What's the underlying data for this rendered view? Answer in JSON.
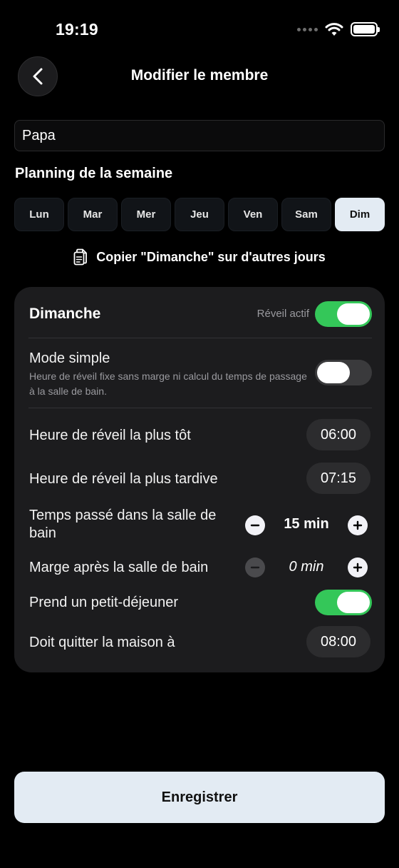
{
  "status_bar": {
    "time": "19:19"
  },
  "header": {
    "title": "Modifier le membre"
  },
  "member": {
    "name": "Papa"
  },
  "schedule": {
    "section_title": "Planning de la semaine",
    "days": [
      "Lun",
      "Mar",
      "Mer",
      "Jeu",
      "Ven",
      "Sam",
      "Dim"
    ],
    "active_day": "Dim",
    "copy_label": "Copier \"Dimanche\" sur d'autres jours"
  },
  "day_card": {
    "title": "Dimanche",
    "alarm_label": "Réveil actif",
    "alarm_active": true,
    "simple_mode": {
      "label": "Mode simple",
      "description": "Heure de réveil fixe sans marge ni calcul du temps de passage à la salle de bain.",
      "enabled": false
    },
    "earliest_wake": {
      "label": "Heure de réveil la plus tôt",
      "value": "06:00"
    },
    "latest_wake": {
      "label": "Heure de réveil la plus tardive",
      "value": "07:15"
    },
    "bathroom_time": {
      "label": "Temps passé dans la salle de bain",
      "value": "15 min"
    },
    "bathroom_margin": {
      "label": "Marge après la salle de bain",
      "value": "0 min"
    },
    "breakfast": {
      "label": "Prend un petit-déjeuner",
      "enabled": true
    },
    "leave_time": {
      "label": "Doit quitter la maison à",
      "value": "08:00"
    }
  },
  "footer": {
    "save_label": "Enregistrer"
  },
  "colors": {
    "background": "#000000",
    "card": "#1c1c1e",
    "toggle_on": "#34c759",
    "toggle_off": "#3a3a3c",
    "accent_light": "#e3ebf3"
  },
  "icons": {
    "back": "chevron-left-icon",
    "copy": "copy-icon",
    "minus": "minus-icon",
    "plus": "plus-icon",
    "wifi": "wifi-icon",
    "battery": "battery-icon",
    "signal": "signal-icon"
  }
}
